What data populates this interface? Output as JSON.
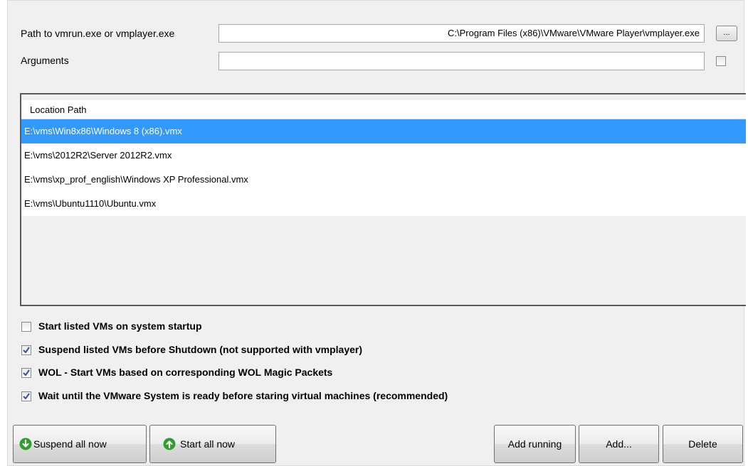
{
  "settings": {
    "path_label": "Path to vmrun.exe or vmplayer.exe",
    "path_value": "C:\\Program Files (x86)\\VMware\\VMware Player\\vmplayer.exe",
    "browse_label": "...",
    "arguments_label": "Arguments",
    "arguments_value": "",
    "arguments_checkbox_checked": false
  },
  "vm_list": {
    "column_header": "Location Path",
    "rows": [
      {
        "path": "E:\\vms\\Win8x86\\Windows 8 (x86).vmx",
        "selected": true
      },
      {
        "path": "E:\\vms\\2012R2\\Server 2012R2.vmx",
        "selected": false
      },
      {
        "path": "E:\\vms\\xp_prof_english\\Windows XP Professional.vmx",
        "selected": false
      },
      {
        "path": "E:\\vms\\Ubuntu1110\\Ubuntu.vmx",
        "selected": false
      }
    ]
  },
  "options": [
    {
      "label": "Start listed  VMs on system startup",
      "checked": false
    },
    {
      "label": "Suspend listed VMs before Shutdown (not supported with vmplayer)",
      "checked": true
    },
    {
      "label": "WOL - Start VMs based on corresponding WOL Magic Packets",
      "checked": true
    },
    {
      "label": "Wait until the VMware System is ready before staring virtual machines (recommended)",
      "checked": true
    }
  ],
  "buttons": {
    "suspend_all": "Suspend all now",
    "start_all": "Start all now",
    "add_running": "Add running",
    "add": "Add...",
    "delete": "Delete"
  },
  "icons": {
    "suspend": "green-down-arrow-circle-icon",
    "start": "green-up-arrow-circle-icon"
  },
  "colors": {
    "selection": "#3399ff",
    "panel": "#f0f0f0",
    "icon_green": "#2e9e2e"
  }
}
